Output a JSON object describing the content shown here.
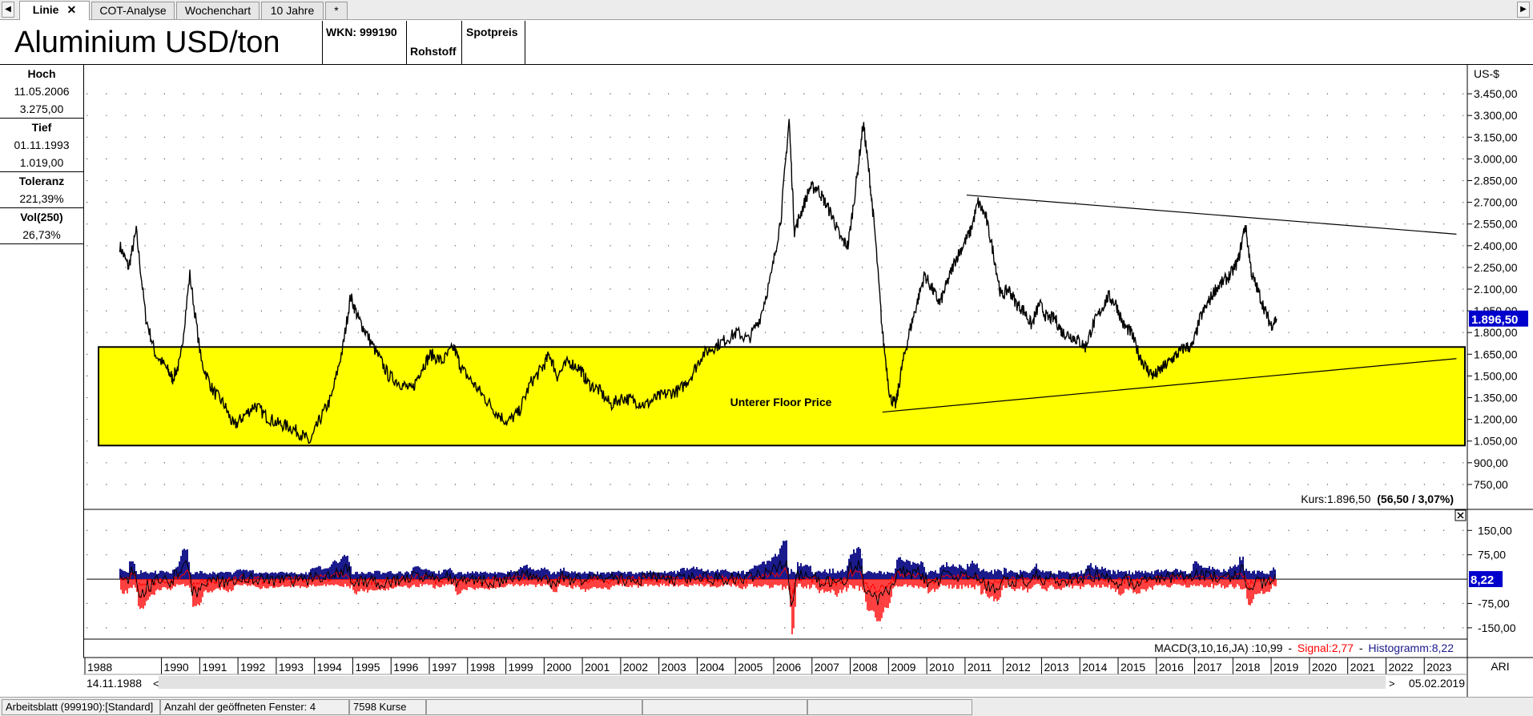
{
  "tabs": [
    {
      "label": "Linie",
      "active": true
    },
    {
      "label": "COT-Analyse",
      "active": false
    },
    {
      "label": "Wochenchart",
      "active": false
    },
    {
      "label": "10 Jahre",
      "active": false
    },
    {
      "label": "*",
      "active": false
    }
  ],
  "tab_close": "✕",
  "nav": {
    "left": "◀",
    "right": "▶"
  },
  "header": {
    "title": "Aluminium USD/ton",
    "wkn": "WKN: 999190",
    "type": "Rohstoff",
    "price_kind": "Spotpreis"
  },
  "info": {
    "high": {
      "label": "Hoch",
      "date": "11.05.2006",
      "value": "3.275,00"
    },
    "low": {
      "label": "Tief",
      "date": "01.11.1993",
      "value": "1.019,00"
    },
    "tolerance": {
      "label": "Toleranz",
      "value": "221,39%"
    },
    "vol": {
      "label": "Vol(250)",
      "value": "26,73%"
    }
  },
  "chart_data": [
    {
      "type": "line",
      "title": "Aluminium USD/ton",
      "unit": "US-$",
      "ylim": [
        600,
        3600
      ],
      "xlim": [
        1988,
        2024
      ],
      "yticks": [
        750,
        900,
        1050,
        1200,
        1350,
        1500,
        1650,
        1800,
        1950,
        2100,
        2250,
        2400,
        2550,
        2700,
        2850,
        3000,
        3150,
        3300,
        3450
      ],
      "ytick_labels": [
        "750,00",
        "900,00",
        "1.050,00",
        "1.200,00",
        "1.350,00",
        "1.500,00",
        "1.650,00",
        "1.800,00",
        "1.950,00",
        "2.100,00",
        "2.250,00",
        "2.400,00",
        "2.550,00",
        "2.700,00",
        "2.850,00",
        "3.000,00",
        "3.150,00",
        "3.300,00",
        "3.450,00"
      ],
      "x": [
        1988.87,
        1989.1,
        1989.3,
        1989.55,
        1989.8,
        1990.1,
        1990.25,
        1990.45,
        1990.7,
        1991.0,
        1991.3,
        1991.6,
        1991.85,
        1992.1,
        1992.4,
        1992.7,
        1993.0,
        1993.3,
        1993.6,
        1993.84,
        1994.1,
        1994.4,
        1994.7,
        1994.9,
        1995.1,
        1995.3,
        1995.6,
        1995.9,
        1996.2,
        1996.5,
        1996.75,
        1997.0,
        1997.3,
        1997.6,
        1997.8,
        1998.1,
        1998.4,
        1998.7,
        1999.0,
        1999.3,
        1999.6,
        1999.9,
        2000.1,
        2000.3,
        2000.6,
        2000.9,
        2001.1,
        2001.4,
        2001.7,
        2002.0,
        2002.3,
        2002.6,
        2002.9,
        2003.2,
        2003.5,
        2003.8,
        2004.1,
        2004.4,
        2004.7,
        2005.0,
        2005.3,
        2005.6,
        2005.9,
        2006.15,
        2006.36,
        2006.5,
        2006.7,
        2006.9,
        2007.1,
        2007.3,
        2007.5,
        2007.7,
        2007.9,
        2008.1,
        2008.3,
        2008.45,
        2008.6,
        2008.8,
        2009.0,
        2009.15,
        2009.3,
        2009.5,
        2009.7,
        2009.9,
        2010.1,
        2010.3,
        2010.5,
        2010.7,
        2010.9,
        2011.1,
        2011.3,
        2011.5,
        2011.7,
        2011.9,
        2012.1,
        2012.3,
        2012.5,
        2012.7,
        2012.9,
        2013.1,
        2013.3,
        2013.5,
        2013.7,
        2013.9,
        2014.1,
        2014.3,
        2014.5,
        2014.7,
        2014.9,
        2015.1,
        2015.3,
        2015.5,
        2015.7,
        2015.9,
        2016.1,
        2016.3,
        2016.5,
        2016.7,
        2016.9,
        2017.1,
        2017.3,
        2017.5,
        2017.7,
        2017.9,
        2018.1,
        2018.28,
        2018.45,
        2018.6,
        2018.8,
        2018.95,
        2019.1
      ],
      "y": [
        2400,
        2250,
        2500,
        1900,
        1650,
        1550,
        1480,
        1600,
        2200,
        1600,
        1400,
        1300,
        1150,
        1220,
        1300,
        1220,
        1170,
        1150,
        1100,
        1040,
        1200,
        1350,
        1700,
        2050,
        1900,
        1800,
        1650,
        1500,
        1450,
        1400,
        1550,
        1650,
        1600,
        1700,
        1550,
        1450,
        1350,
        1250,
        1180,
        1250,
        1450,
        1550,
        1650,
        1500,
        1600,
        1550,
        1450,
        1400,
        1300,
        1350,
        1330,
        1300,
        1350,
        1380,
        1400,
        1500,
        1650,
        1700,
        1750,
        1800,
        1750,
        1900,
        2200,
        2600,
        3275,
        2500,
        2650,
        2800,
        2800,
        2700,
        2600,
        2450,
        2400,
        2800,
        3250,
        2900,
        2500,
        1800,
        1350,
        1300,
        1550,
        1800,
        2000,
        2200,
        2100,
        2000,
        2150,
        2300,
        2400,
        2500,
        2700,
        2600,
        2350,
        2050,
        2100,
        2000,
        1950,
        1850,
        2000,
        1900,
        1900,
        1800,
        1780,
        1750,
        1700,
        1850,
        1950,
        2050,
        2000,
        1850,
        1800,
        1650,
        1550,
        1500,
        1550,
        1600,
        1650,
        1700,
        1700,
        1900,
        2000,
        2100,
        2150,
        2200,
        2300,
        2550,
        2200,
        2100,
        1950,
        1850,
        1896.5
      ],
      "current": {
        "label": "1.896,50",
        "value": 1896.5
      },
      "annotation": "Unterer Floor Price",
      "floor_zone": [
        1019,
        1700
      ],
      "trendlines": [
        {
          "from": [
            2011.0,
            2750
          ],
          "to": [
            2023.8,
            2480
          ]
        },
        {
          "from": [
            2008.8,
            1250
          ],
          "to": [
            2023.8,
            1620
          ]
        }
      ],
      "kurs_label": "Kurs:1.896,50",
      "kurs_change": "(56,50 / 3,07%)"
    },
    {
      "type": "bar",
      "title": "MACD(3,10,16,JA) :10,99",
      "signal_label": "Signal:2,77",
      "histogram_label": "Histogramm:8,22",
      "ylim": [
        -175,
        200
      ],
      "yticks": [
        150,
        75,
        -75,
        -150
      ],
      "ytick_labels": [
        "150,00",
        "75,00",
        "-75,00",
        "-150,00"
      ],
      "current": {
        "label": "8,22",
        "value": 8.22
      },
      "colors": {
        "macd": "#000000",
        "signal": "#ff0000",
        "histogram": "#1a1a8c"
      }
    }
  ],
  "axis": {
    "years": [
      "1988",
      "1990",
      "1991",
      "1992",
      "1993",
      "1994",
      "1995",
      "1996",
      "1997",
      "1998",
      "1999",
      "2000",
      "2001",
      "2002",
      "2003",
      "2004",
      "2005",
      "2006",
      "2007",
      "2008",
      "2009",
      "2010",
      "2011",
      "2012",
      "2013",
      "2014",
      "2015",
      "2016",
      "2017",
      "2018",
      "2019",
      "2020",
      "2021",
      "2022",
      "2023"
    ],
    "start_date": "14.11.1988",
    "end_date": "05.02.2019",
    "scroll_left": "<",
    "scroll_right": ">",
    "ari": "ARI"
  },
  "status": {
    "sheet": "Arbeitsblatt (999190):[Standard]",
    "windows": "Anzahl der geöffneten Fenster: 4",
    "count": "7598 Kurse"
  },
  "colors": {
    "floor": "#ffff00",
    "current_badge": "#0000cc",
    "signal": "#ff0000",
    "histogram": "#1a1a8c"
  }
}
